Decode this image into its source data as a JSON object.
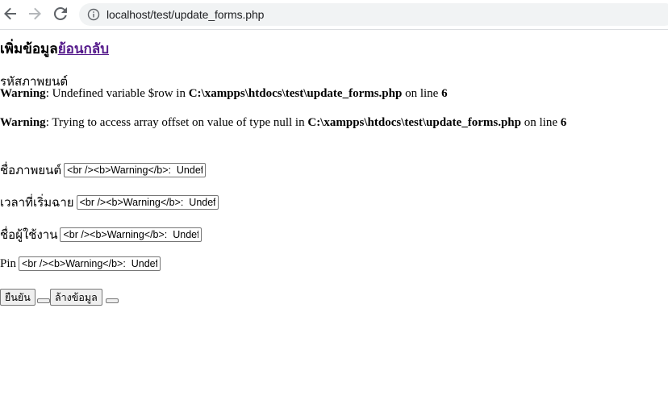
{
  "browser": {
    "url": "localhost/test/update_forms.php"
  },
  "page": {
    "heading": "เพิ่มข้อมูล",
    "back_link": "ย้อนกลับ",
    "movie_id_label": "รหัสภาพยนต์",
    "warning1": {
      "prefix": "Warning",
      "message": ": Undefined variable $row in ",
      "path": "C:\\xampps\\htdocs\\test\\update_forms.php",
      "on_line": " on line ",
      "line": "6"
    },
    "warning2": {
      "prefix": "Warning",
      "message": ": Trying to access array offset on value of type null in ",
      "path": "C:\\xampps\\htdocs\\test\\update_forms.php",
      "on_line": " on line ",
      "line": "6"
    },
    "fields": [
      {
        "label": "ชื่อภาพยนต์",
        "value": "<br /><b>Warning</b>:  Undefined variable $row"
      },
      {
        "label": "เวลาที่เริ่มฉาย",
        "value": "<br /><b>Warning</b>:  Undefined variable $row"
      },
      {
        "label": "ชื่อผู้ใช้งาน",
        "value": "<br /><b>Warning</b>:  Undefined variable $row"
      },
      {
        "label": "Pin",
        "value": "<br /><b>Warning</b>:  Undefined variable $row"
      }
    ],
    "buttons": {
      "submit": "ยืนยัน",
      "clear": "ล้างข้อมูล"
    }
  }
}
